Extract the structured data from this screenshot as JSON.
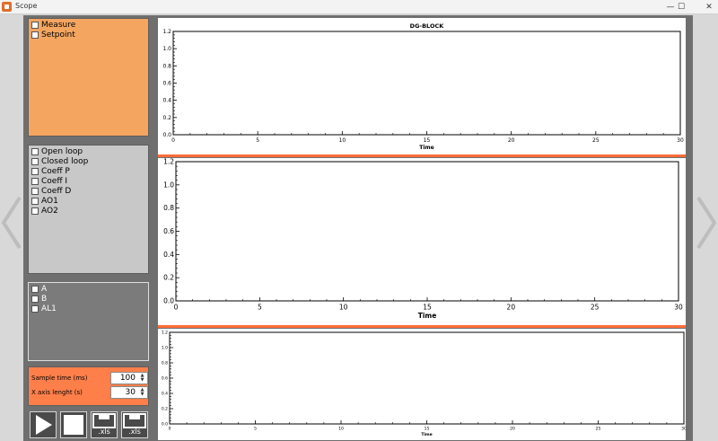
{
  "window": {
    "title": "Scope",
    "minimize": "—",
    "maximize": "☐",
    "close": "✕"
  },
  "nav": {
    "prev_icon": "chevron-left-icon",
    "next_icon": "chevron-right-icon"
  },
  "panels": {
    "signals": [
      {
        "label": "Measure"
      },
      {
        "label": "Setpoint"
      }
    ],
    "loops": [
      {
        "label": "Open loop"
      },
      {
        "label": "Closed loop"
      },
      {
        "label": "Coeff P"
      },
      {
        "label": "Coeff I"
      },
      {
        "label": "Coeff D"
      },
      {
        "label": "AO1"
      },
      {
        "label": "AO2"
      }
    ],
    "alarms": [
      {
        "label": "A"
      },
      {
        "label": "B"
      },
      {
        "label": "AL1"
      }
    ]
  },
  "settings": {
    "sample_time_label": "Sample time (ms)",
    "sample_time_value": "100",
    "x_axis_label": "X axis lenght (s)",
    "x_axis_value": "30"
  },
  "toolbar": {
    "play_icon": "play-icon",
    "stop_icon": "stop-icon",
    "export_label": ".xls",
    "save_label": ".xls"
  },
  "colors": {
    "orange_panel": "#f4a661",
    "settings_panel": "#ff7f4a",
    "divider": "#ff6d3a",
    "background": "#6f6f6f"
  },
  "chart_data": [
    {
      "type": "line",
      "title": "DG-BLOCK",
      "xlabel": "Time",
      "ylabel": "",
      "xlim": [
        0,
        30
      ],
      "ylim": [
        0,
        1.2
      ],
      "x_ticks": [
        "0",
        "5",
        "10",
        "15",
        "20",
        "25",
        "30"
      ],
      "y_ticks": [
        "0.0",
        "0.2",
        "0.4",
        "0.6",
        "0.8",
        "1.0",
        "1.2"
      ],
      "series": []
    },
    {
      "type": "line",
      "title": "",
      "xlabel": "Time",
      "ylabel": "",
      "xlim": [
        0,
        30
      ],
      "ylim": [
        0,
        1.2
      ],
      "x_ticks": [
        "0",
        "5",
        "10",
        "15",
        "20",
        "25",
        "30"
      ],
      "y_ticks": [
        "0.0",
        "0.2",
        "0.4",
        "0.6",
        "0.8",
        "1.0",
        "1.2"
      ],
      "series": []
    },
    {
      "type": "line",
      "title": "",
      "xlabel": "Time",
      "ylabel": "",
      "xlim": [
        0,
        30
      ],
      "ylim": [
        0,
        1.2
      ],
      "x_ticks": [
        "0",
        "5",
        "10",
        "15",
        "20",
        "25",
        "30"
      ],
      "y_ticks": [
        "0.0",
        "0.2",
        "0.4",
        "0.6",
        "0.8",
        "1.0",
        "1.2"
      ],
      "series": []
    }
  ]
}
